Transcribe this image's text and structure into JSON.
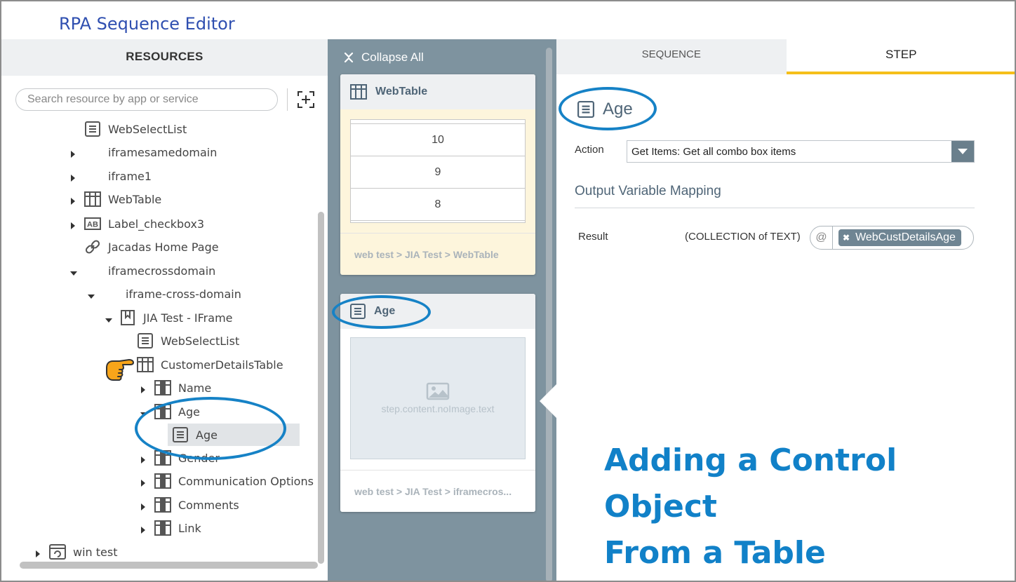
{
  "app": {
    "title": "RPA Sequence Editor"
  },
  "resources": {
    "header": "RESOURCES",
    "search_placeholder": "Search resource by app or service",
    "tree": [
      {
        "label": "WebSelectList",
        "icon": "list-icon",
        "expander": "none"
      },
      {
        "label": "iframesamedomain",
        "icon": "none",
        "expander": "collapsed"
      },
      {
        "label": "iframe1",
        "icon": "none",
        "expander": "collapsed"
      },
      {
        "label": "WebTable",
        "icon": "table-icon",
        "expander": "collapsed"
      },
      {
        "label": "Label_checkbox3",
        "icon": "label-ab-icon",
        "expander": "collapsed"
      },
      {
        "label": "Jacadas Home Page",
        "icon": "link-icon",
        "expander": "none"
      },
      {
        "label": "iframecrossdomain",
        "icon": "none",
        "expander": "expanded"
      },
      {
        "label": "iframe-cross-domain",
        "icon": "none",
        "expander": "expanded"
      },
      {
        "label": "JIA Test - IFrame",
        "icon": "page-icon",
        "expander": "expanded"
      },
      {
        "label": "WebSelectList",
        "icon": "list-icon",
        "expander": "none"
      },
      {
        "label": "CustomerDetailsTable",
        "icon": "table-icon",
        "expander": "none"
      },
      {
        "label": "Name",
        "icon": "column-icon",
        "expander": "collapsed"
      },
      {
        "label": "Age",
        "icon": "column-icon",
        "expander": "expanded"
      },
      {
        "label": "Age",
        "icon": "list-icon",
        "expander": "none",
        "selected": true
      },
      {
        "label": "Gender",
        "icon": "column-icon",
        "expander": "collapsed"
      },
      {
        "label": "Communication Options",
        "icon": "column-icon",
        "expander": "collapsed"
      },
      {
        "label": "Comments",
        "icon": "column-icon",
        "expander": "collapsed"
      },
      {
        "label": "Link",
        "icon": "column-icon",
        "expander": "collapsed"
      },
      {
        "label": "win test",
        "icon": "window-icon",
        "expander": "collapsed"
      }
    ]
  },
  "sequence": {
    "collapse_all": "Collapse All",
    "cards": [
      {
        "title": "WebTable",
        "icon": "table-icon",
        "thumbnail_rows": [
          "10",
          "9",
          "8"
        ],
        "path": "web test > JIA Test > WebTable"
      },
      {
        "title": "Age",
        "icon": "list-icon",
        "no_image_text": "step.content.noImage.text",
        "path": "web test > JIA Test > iframecros..."
      }
    ]
  },
  "step_panel": {
    "tabs": {
      "sequence": "SEQUENCE",
      "step": "STEP"
    },
    "active_tab": "STEP",
    "title": "Age",
    "action_label": "Action",
    "action_value": "Get Items: Get all combo box items",
    "output_heading": "Output Variable Mapping",
    "result_label": "Result",
    "result_type": "(COLLECTION of TEXT)",
    "at_symbol": "@",
    "variable": "WebCustDetailsAge"
  },
  "caption": {
    "line1": "Adding a Control Object",
    "line2": "From a Table"
  },
  "colors": {
    "accent_tab": "#f5bf1a",
    "annotation": "#1682c6",
    "caption": "#1181c8",
    "mid_panel": "#7e939f"
  }
}
